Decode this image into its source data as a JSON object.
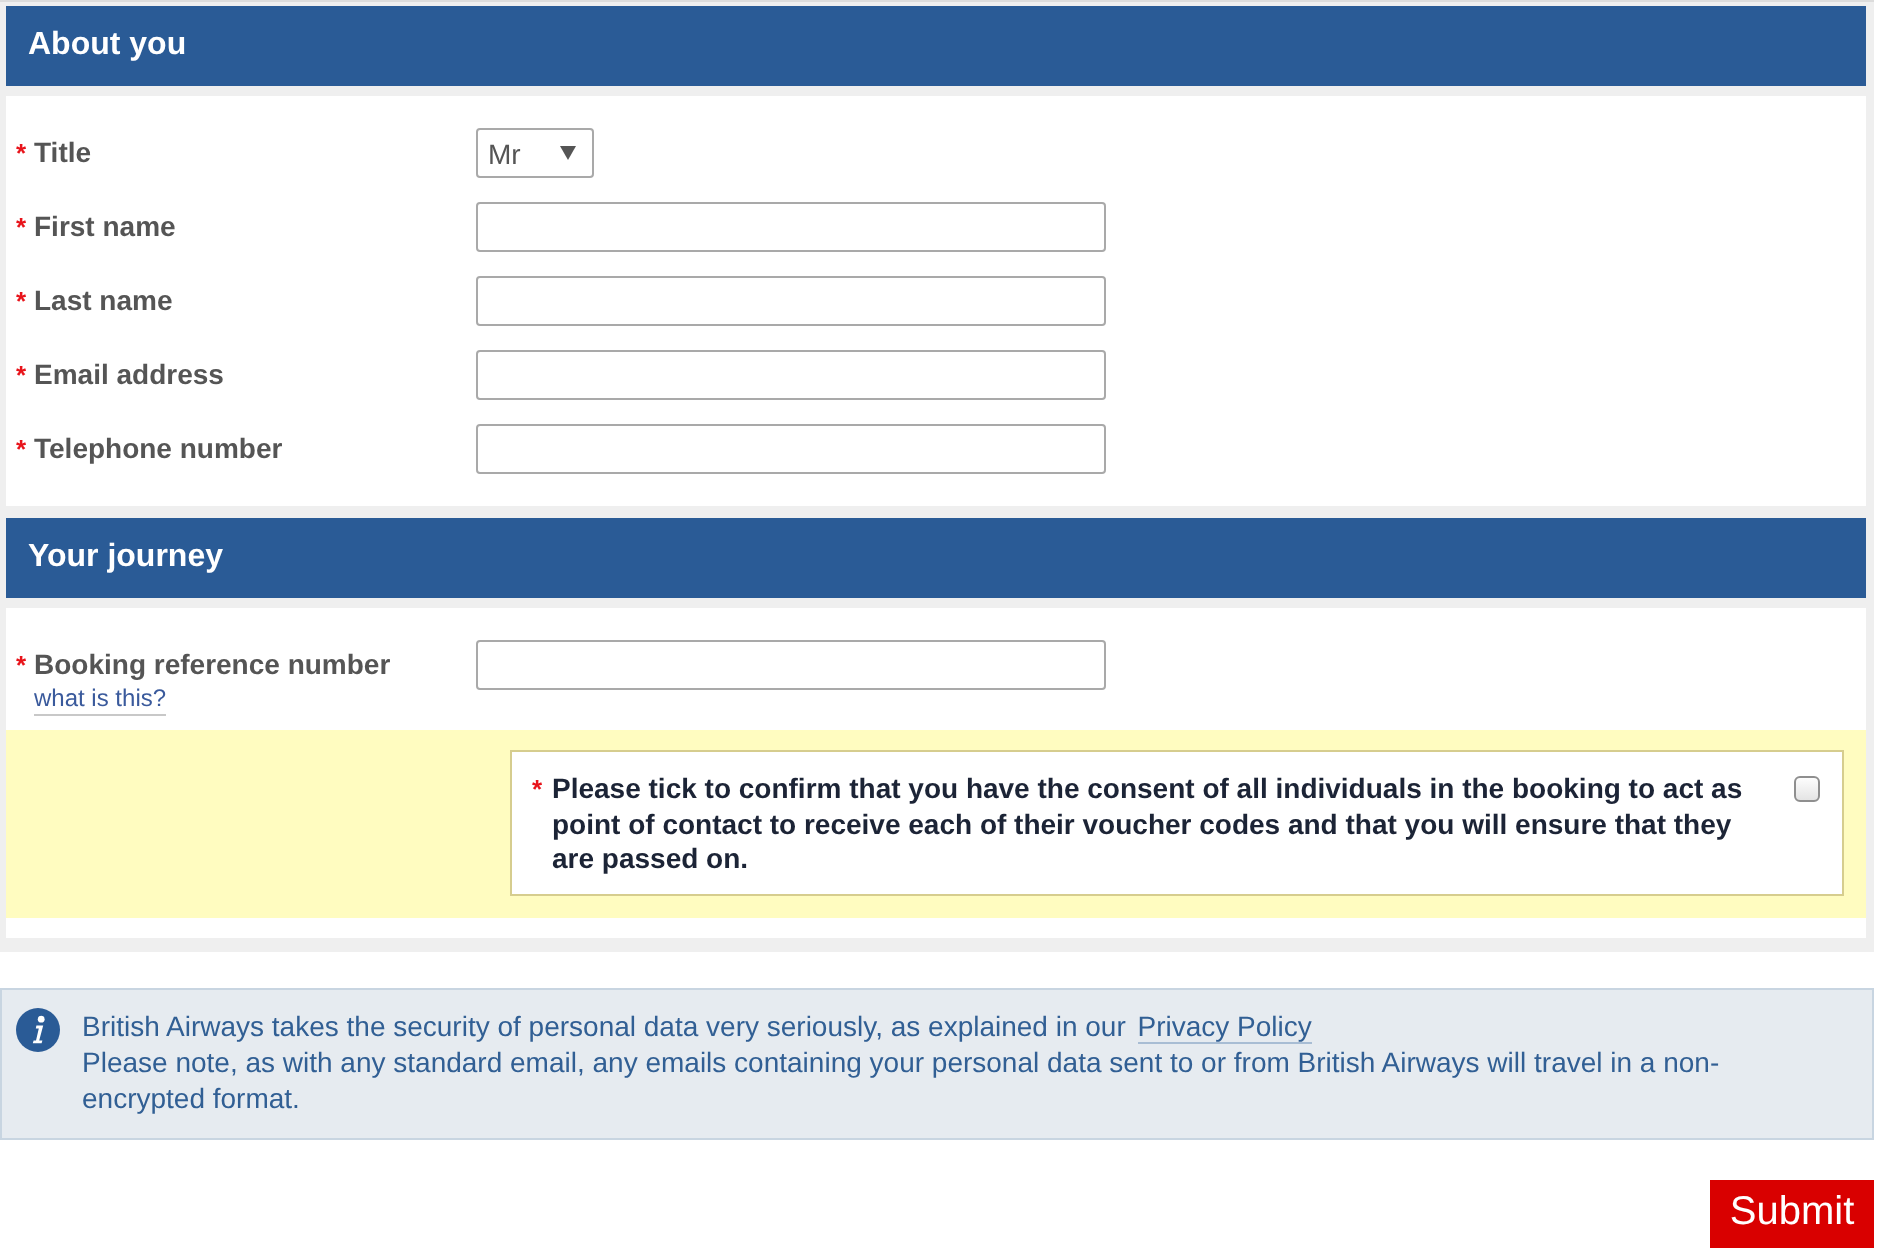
{
  "sections": [
    {
      "title": "About you",
      "fields": [
        {
          "kind": "select",
          "mark": "*",
          "label": "Title",
          "value": "Mr"
        },
        {
          "kind": "text",
          "mark": "*",
          "label": "First name"
        },
        {
          "kind": "text",
          "mark": "*",
          "label": "Last name"
        },
        {
          "kind": "text",
          "mark": "*",
          "label": "Email address"
        },
        {
          "kind": "text",
          "mark": "*",
          "label": "Telephone number"
        }
      ]
    },
    {
      "title": "Your journey",
      "fields": [
        {
          "kind": "text",
          "mark": "*",
          "label": "Booking reference number",
          "help_link": "what is this?"
        }
      ],
      "consent": {
        "mark": "*",
        "text": "Please tick to confirm that you have the consent of all individuals in the booking to act as point of contact to receive each of their voucher codes and that you will ensure that they are passed on.",
        "checked": false
      }
    }
  ],
  "notice": {
    "text": "British Airways takes the security of personal data very seriously, as explained in our",
    "link": "Privacy Policy",
    "text_2": "Please note, as with any standard email, any emails containing your personal data sent to or from British Airways will travel in a non-encrypted format."
  },
  "submit_button": {
    "label": "Submit"
  }
}
